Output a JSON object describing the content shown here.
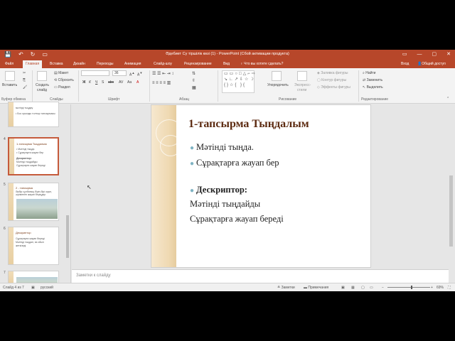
{
  "window": {
    "title": "Әдебиет Су тіршілік көзі (1) - PowerPoint (Сбой активации продукта)",
    "qat": [
      "💾",
      "↶",
      "↻",
      "▭"
    ],
    "controls": [
      "▭",
      "—",
      "▢",
      "✕"
    ]
  },
  "tabs": {
    "items": [
      "Файл",
      "Главная",
      "Вставка",
      "Дизайн",
      "Переходы",
      "Анимация",
      "Слайд-шоу",
      "Рецензирование",
      "Вид"
    ],
    "active": "Главная",
    "search_hint": "♀ Что вы хотите сделать?",
    "signin": "Вход",
    "share": "Общий доступ"
  },
  "ribbon": {
    "paste": "Вставить",
    "new_slide_l1": "Создать",
    "new_slide_l2": "слайд",
    "layout": "Макет",
    "reset": "Сбросить",
    "section": "Раздел",
    "font_name": "",
    "font_size": "36",
    "arrange": "Упорядочить",
    "express_l1": "Экспресс-",
    "express_l2": "стили",
    "fill": "Заливка фигуры",
    "outline": "Контур фигуры",
    "effects": "Эффекты фигуры",
    "find": "Найти",
    "replace": "Заменить",
    "select": "Выделить",
    "groups": {
      "clipboard": "Буфер обмена",
      "slides": "Слайды",
      "font": "Шрифт",
      "paragraph": "Абзац",
      "drawing": "Рисование",
      "editing": "Редактирование"
    },
    "shape_glyphs": "▭▭○□△⌐⇨\n↘∟↗⇩☆☽\n{}☆{ }{"
  },
  "thumbnails": [
    {
      "num": "",
      "title": "",
      "lines": [
        "мәтінді тыңдау",
        "• Бос орынды толтыр тапсырмасы"
      ]
    },
    {
      "num": "4",
      "title": "1-тапсырма Тыңдалым",
      "lines": [
        "• Мәтінді тыңда.",
        "• Сұрақтарға жауап бер",
        "Дескриптор:",
        "Мәтінді тыңдайды",
        "Сұрақтарға жауап береді"
      ]
    },
    {
      "num": "5",
      "title": "2 - тапсырма",
      "lines": [
        "Әрбір сұлбаның бірін-бірі оқып, әңгімелеп жауап беріңдер"
      ]
    },
    {
      "num": "6",
      "title": "Дескриптор",
      "lines": [
        "Сұрақтарға жауап береді",
        "Мәтінді тыңдап, өз ойын",
        "жеткізеді"
      ]
    },
    {
      "num": "7",
      "title": "",
      "lines": []
    }
  ],
  "slide": {
    "title": "1-тапсырма Тыңдалым",
    "bullet1": "Мәтінді тыңда.",
    "bullet2": "Сұрақтарға жауап бер",
    "descriptor": "Дескриптор:",
    "line1": "Мәтінді тыңдайды",
    "line2": "Сұрақтарға жауап береді"
  },
  "notes": {
    "placeholder": "Заметки к слайду"
  },
  "status": {
    "slide_count": "Слайд 4 из 7",
    "language": "русский",
    "notes_btn": "Заметки",
    "comments_btn": "Примечания",
    "zoom": "69%"
  }
}
